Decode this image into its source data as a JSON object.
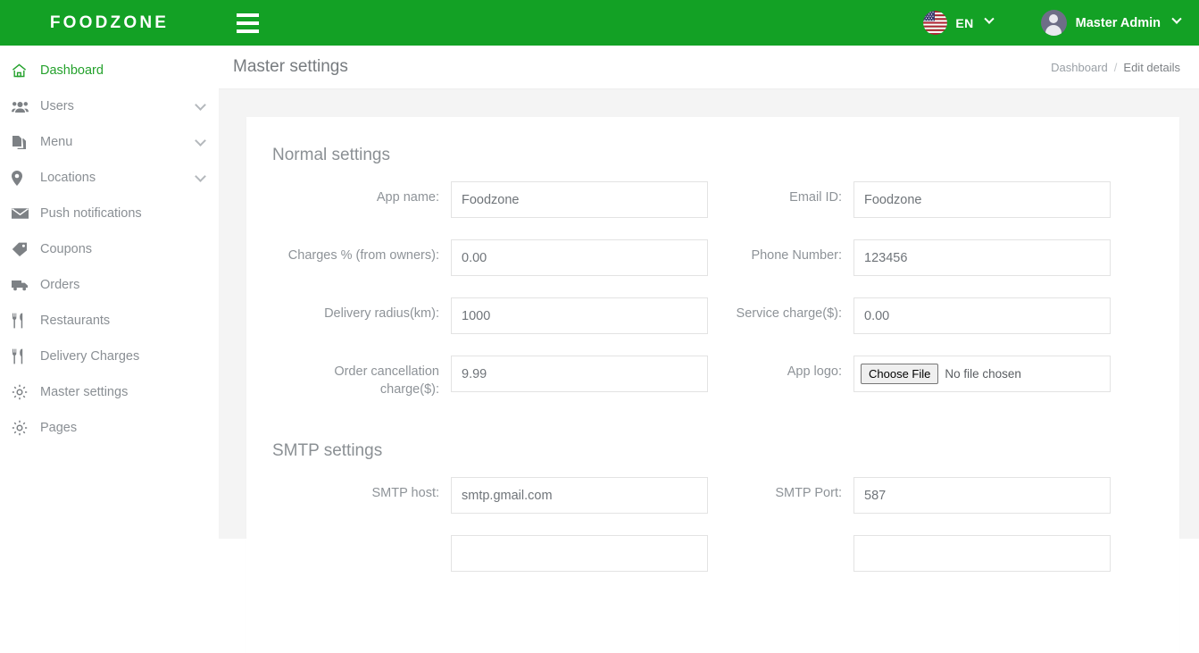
{
  "theme": {
    "brand_green": "#13a125",
    "active_green": "#24a12c",
    "content_bg": "#f4f4f4",
    "card_bg": "#ffffff"
  },
  "header": {
    "brand": "FOODZONE",
    "menu_toggle_name": "hamburger-menu",
    "language": {
      "label": "EN",
      "flag": "us-flag-icon"
    },
    "user": {
      "name": "Master Admin",
      "avatar": "user-avatar-icon"
    }
  },
  "sidebar": {
    "items": [
      {
        "label": "Dashboard",
        "icon": "home-icon",
        "active": true,
        "expandable": false
      },
      {
        "label": "Users",
        "icon": "users-icon",
        "active": false,
        "expandable": true
      },
      {
        "label": "Menu",
        "icon": "file-copy-icon",
        "active": false,
        "expandable": true
      },
      {
        "label": "Locations",
        "icon": "map-pin-icon",
        "active": false,
        "expandable": true
      },
      {
        "label": "Push notifications",
        "icon": "envelope-icon",
        "active": false,
        "expandable": false
      },
      {
        "label": "Coupons",
        "icon": "tag-icon",
        "active": false,
        "expandable": false
      },
      {
        "label": "Orders",
        "icon": "truck-icon",
        "active": false,
        "expandable": false
      },
      {
        "label": "Restaurants",
        "icon": "utensils-icon",
        "active": false,
        "expandable": false
      },
      {
        "label": "Delivery Charges",
        "icon": "utensils-icon",
        "active": false,
        "expandable": false
      },
      {
        "label": "Master settings",
        "icon": "gear-icon",
        "active": false,
        "expandable": false
      },
      {
        "label": "Pages",
        "icon": "gear-icon",
        "active": false,
        "expandable": false
      }
    ]
  },
  "page": {
    "title": "Master settings",
    "breadcrumb": {
      "root": "Dashboard",
      "separator": "/",
      "current": "Edit details"
    }
  },
  "form": {
    "normal_settings_title": "Normal settings",
    "smtp_settings_title": "SMTP settings",
    "fields": {
      "app_name": {
        "label": "App name:",
        "value": "Foodzone"
      },
      "email_id": {
        "label": "Email ID:",
        "value": "Foodzone"
      },
      "charges_percent": {
        "label": "Charges % (from owners):",
        "value": "0.00"
      },
      "phone_number": {
        "label": "Phone Number:",
        "value": "123456"
      },
      "delivery_radius": {
        "label": "Delivery radius(km):",
        "value": "1000"
      },
      "service_charge": {
        "label": "Service charge($):",
        "value": "0.00"
      },
      "order_cancel": {
        "label": "Order cancellation charge($):",
        "value": "9.99"
      },
      "app_logo": {
        "label": "App logo:",
        "button": "Choose File",
        "status": "No file chosen"
      },
      "smtp_host": {
        "label": "SMTP host:",
        "value": "smtp.gmail.com"
      },
      "smtp_port": {
        "label": "SMTP Port:",
        "value": "587"
      }
    }
  }
}
